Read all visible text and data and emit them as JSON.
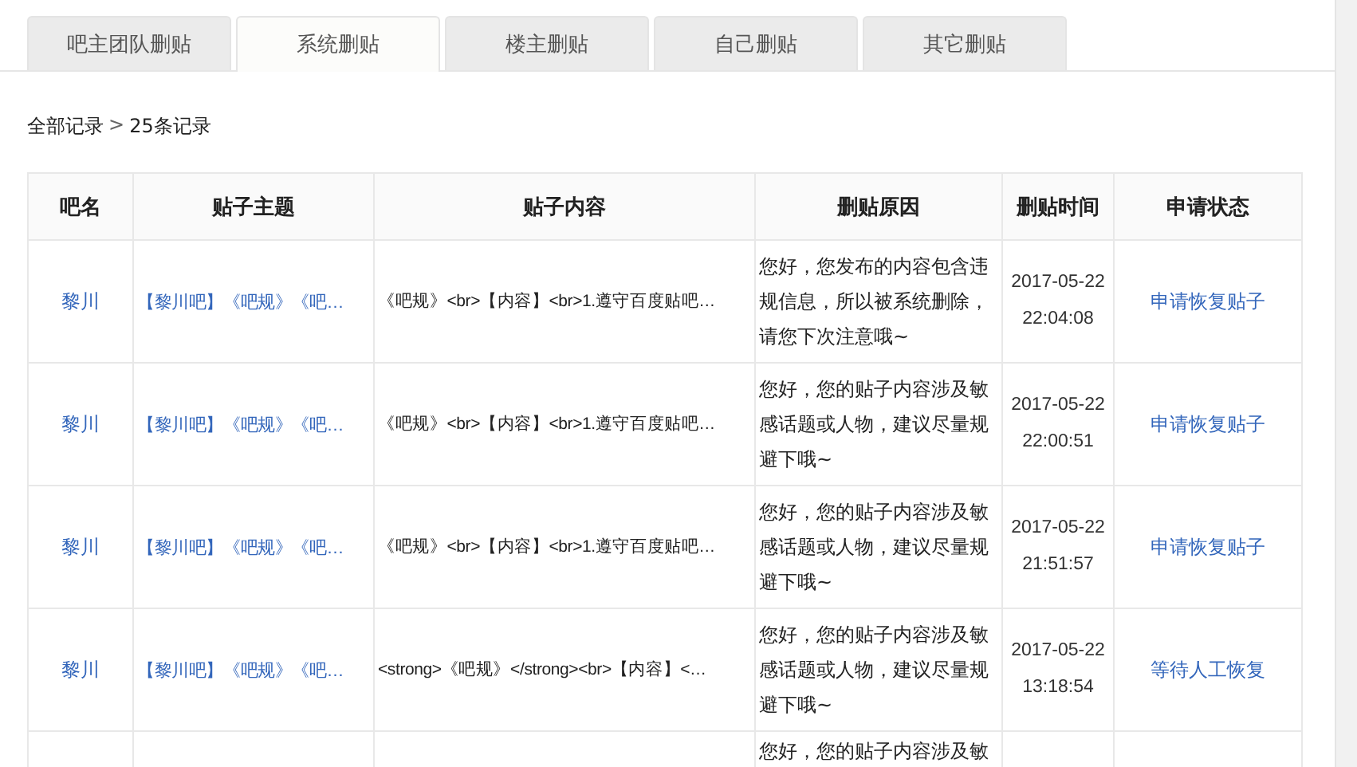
{
  "tabs": [
    {
      "label": "吧主团队删贴",
      "selected": false
    },
    {
      "label": "系统删贴",
      "selected": true
    },
    {
      "label": "楼主删贴",
      "selected": false
    },
    {
      "label": "自己删贴",
      "selected": false
    },
    {
      "label": "其它删贴",
      "selected": false
    }
  ],
  "breadcrumb": {
    "root": "全部记录",
    "separator": ">",
    "count": "25条记录"
  },
  "table": {
    "columns": [
      "吧名",
      "贴子主题",
      "贴子内容",
      "删贴原因",
      "删贴时间",
      "申请状态"
    ],
    "rows": [
      {
        "forum": "黎川",
        "topic": "【黎川吧】《吧规》《吧…",
        "content": "《吧规》<br>【内容】<br>1.遵守百度贴吧…",
        "reason": "您好，您发布的内容包含违规信息，所以被系统删除，请您下次注意哦~",
        "date": "2017-05-22",
        "time": "22:04:08",
        "status": "申请恢复贴子"
      },
      {
        "forum": "黎川",
        "topic": "【黎川吧】《吧规》《吧…",
        "content": "《吧规》<br>【内容】<br>1.遵守百度贴吧…",
        "reason": "您好，您的贴子内容涉及敏感话题或人物，建议尽量规避下哦~",
        "date": "2017-05-22",
        "time": "22:00:51",
        "status": "申请恢复贴子"
      },
      {
        "forum": "黎川",
        "topic": "【黎川吧】《吧规》《吧…",
        "content": "《吧规》<br>【内容】<br>1.遵守百度贴吧…",
        "reason": "您好，您的贴子内容涉及敏感话题或人物，建议尽量规避下哦~",
        "date": "2017-05-22",
        "time": "21:51:57",
        "status": "申请恢复贴子"
      },
      {
        "forum": "黎川",
        "topic": "【黎川吧】《吧规》《吧…",
        "content": "<strong>《吧规》</strong><br>【内容】<…",
        "reason": "您好，您的贴子内容涉及敏感话题或人物，建议尽量规避下哦~",
        "date": "2017-05-22",
        "time": "13:18:54",
        "status": "等待人工恢复"
      },
      {
        "reason": "您好，您的贴子内容涉及敏"
      }
    ]
  }
}
